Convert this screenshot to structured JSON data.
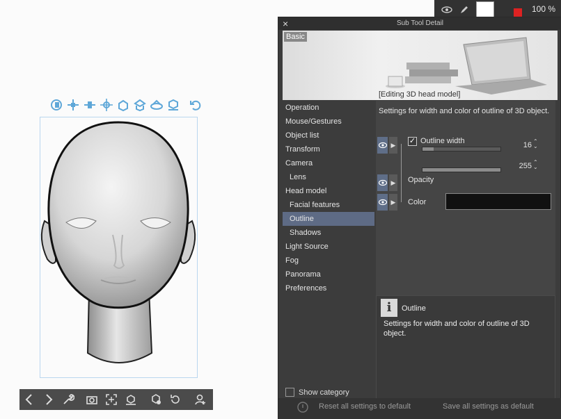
{
  "toolbar_top": {
    "icons": [
      "rotate-camera-icon",
      "pan-camera-icon",
      "dolly-camera-icon",
      "move-object-icon",
      "rotate-object-icon",
      "rotate-object-xy-icon",
      "rotate-object-z-icon",
      "snap-object-icon",
      "reset-icon"
    ]
  },
  "bottom_toolbar": {
    "icons": [
      "prev-icon",
      "next-icon",
      "wrench-icon",
      "camera-icon",
      "fit-icon",
      "ground-icon",
      "object-list-icon",
      "rotate-light-icon",
      "add-object-icon"
    ]
  },
  "layer": {
    "opacity": "100 %"
  },
  "dialog": {
    "title": "Sub Tool Detail",
    "close": "×",
    "preview_tag": "Basic",
    "preview_caption": "[Editing 3D head model]",
    "nav": [
      {
        "label": "Operation",
        "sub": false,
        "selected": false
      },
      {
        "label": "Mouse/Gestures",
        "sub": false,
        "selected": false
      },
      {
        "label": "Object list",
        "sub": false,
        "selected": false
      },
      {
        "label": "Transform",
        "sub": false,
        "selected": false
      },
      {
        "label": "Camera",
        "sub": false,
        "selected": false
      },
      {
        "label": "Lens",
        "sub": true,
        "selected": false
      },
      {
        "label": "Head model",
        "sub": false,
        "selected": false
      },
      {
        "label": "Facial features",
        "sub": true,
        "selected": false
      },
      {
        "label": "Outline",
        "sub": true,
        "selected": true
      },
      {
        "label": "Shadows",
        "sub": true,
        "selected": false
      },
      {
        "label": "Light Source",
        "sub": false,
        "selected": false
      },
      {
        "label": "Fog",
        "sub": false,
        "selected": false
      },
      {
        "label": "Panorama",
        "sub": false,
        "selected": false
      },
      {
        "label": "Preferences",
        "sub": false,
        "selected": false
      }
    ],
    "panel_description": "Settings for width and color of outline of 3D object.",
    "outline_width": {
      "label": "Outline width",
      "value": "16",
      "checked": true,
      "fill_fraction": 0.14
    },
    "opacity": {
      "label": "Opacity",
      "value": "255",
      "fill_fraction": 1.0
    },
    "color": {
      "label": "Color",
      "value": "#111111"
    },
    "info": {
      "title": "Outline",
      "text": "Settings for width and color of outline of 3D object."
    },
    "show_category": "Show category",
    "reset_button": "Reset all settings to default",
    "save_button": "Save all settings as default"
  }
}
